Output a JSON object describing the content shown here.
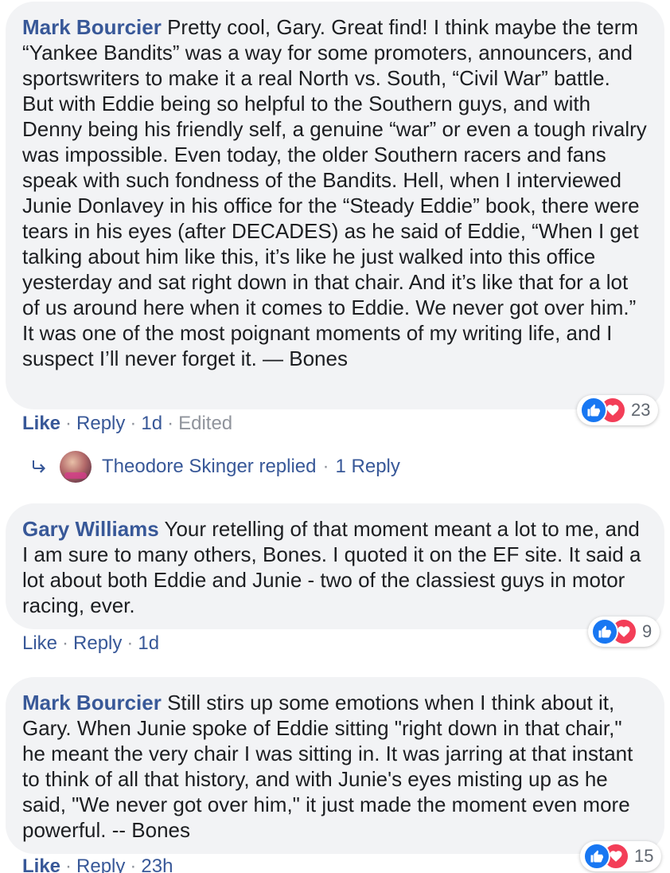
{
  "comments": [
    {
      "author": "Mark Bourcier",
      "text": "Pretty cool, Gary. Great find! I think maybe the term “Yankee Bandits” was a way for some promoters, announcers, and sportswriters to make it a real North vs. South, “Civil War” battle. But with Eddie being so helpful to the Southern guys, and with Denny being his friendly self, a genuine “war” or even a tough rivalry was impossible. Even today, the older Southern racers and fans speak with such fondness of the Bandits. Hell, when I interviewed Junie Donlavey in his office for the “Steady Eddie” book, there were tears in his eyes (after DECADES) as he said of Eddie, “When I get talking about him like this, it’s like he just walked into this office yesterday and sat right down in that chair. And it’s like that for a lot of us around here when it comes to Eddie. We never got over him.” It was one of the most poignant moments of my writing life, and I suspect I’ll never forget it. — Bones",
      "reactions": {
        "count": "23",
        "icons": [
          "like-icon",
          "love-icon"
        ]
      },
      "actions": {
        "like": "Like",
        "reply": "Reply",
        "time": "1d",
        "edited": "Edited"
      }
    },
    {
      "author": "Gary Williams",
      "text": "Your retelling of that moment meant a lot to me, and I am sure to many others, Bones. I quoted it on the EF site. It said a lot about both Eddie and Junie - two of the classiest guys in motor racing, ever.",
      "reactions": {
        "count": "9",
        "icons": [
          "like-icon",
          "love-icon"
        ]
      },
      "actions": {
        "like": "Like",
        "reply": "Reply",
        "time": "1d"
      }
    },
    {
      "author": "Mark Bourcier",
      "text": "Still stirs up some emotions when I think about it, Gary. When Junie spoke of Eddie sitting \"right down in that chair,\" he meant the very chair I was sitting in. It was jarring at that instant to think of all that history, and with Junie's eyes misting up as he said, \"We never got over him,\" it just made the moment even more powerful. -- Bones",
      "reactions": {
        "count": "15",
        "icons": [
          "like-icon",
          "love-icon"
        ]
      },
      "actions": {
        "like": "Like",
        "reply": "Reply",
        "time": "23h"
      }
    }
  ],
  "replies_summary": {
    "name_text": "Theodore Skinger replied",
    "count_text": "1 Reply"
  },
  "colors": {
    "link": "#385898",
    "bubble": "#f2f3f5",
    "meta": "#90949c",
    "like": "#1877f2",
    "love": "#f33e58"
  }
}
